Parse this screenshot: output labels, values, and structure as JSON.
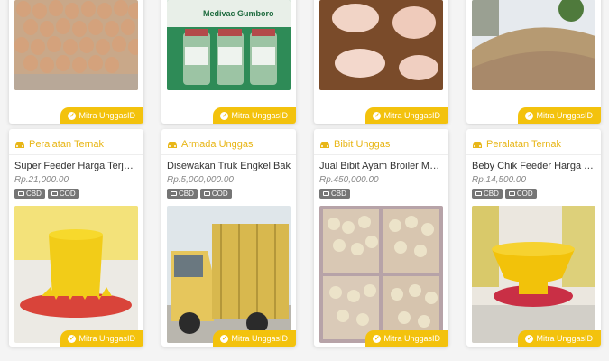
{
  "brand_badge": "Mitra UnggasID",
  "row1": [
    {
      "img": "eggs-tray-photo"
    },
    {
      "img": "vaccine-bottles-photo",
      "caption": "Medivac Gumboro"
    },
    {
      "img": "raw-chicken-photo"
    },
    {
      "img": "sand-pile-photo"
    }
  ],
  "listings": [
    {
      "category": "Peralatan Ternak",
      "title": "Super Feeder Harga Terjangkau",
      "price": "Rp.21,000.00",
      "tags": [
        "CBD",
        "COD"
      ],
      "img": "yellow-feeder-photo"
    },
    {
      "category": "Armada Unggas",
      "title": "Disewakan Truk Engkel Bak",
      "price": "Rp.5,000,000.00",
      "tags": [
        "CBD",
        "COD"
      ],
      "img": "yellow-truck-photo"
    },
    {
      "category": "Bibit Unggas",
      "title": "Jual Bibit Ayam Broiler Merah",
      "price": "Rp.450,000.00",
      "tags": [
        "CBD"
      ],
      "img": "chicks-crate-photo"
    },
    {
      "category": "Peralatan Ternak",
      "title": "Beby Chik Feeder Harga Terjangkau",
      "price": "Rp.14,500.00",
      "tags": [
        "CBD",
        "COD"
      ],
      "img": "chick-feeder-photo"
    }
  ],
  "colors": {
    "accent": "#f3c20d",
    "category_text": "#e8b617",
    "tag_bg": "#757575"
  }
}
